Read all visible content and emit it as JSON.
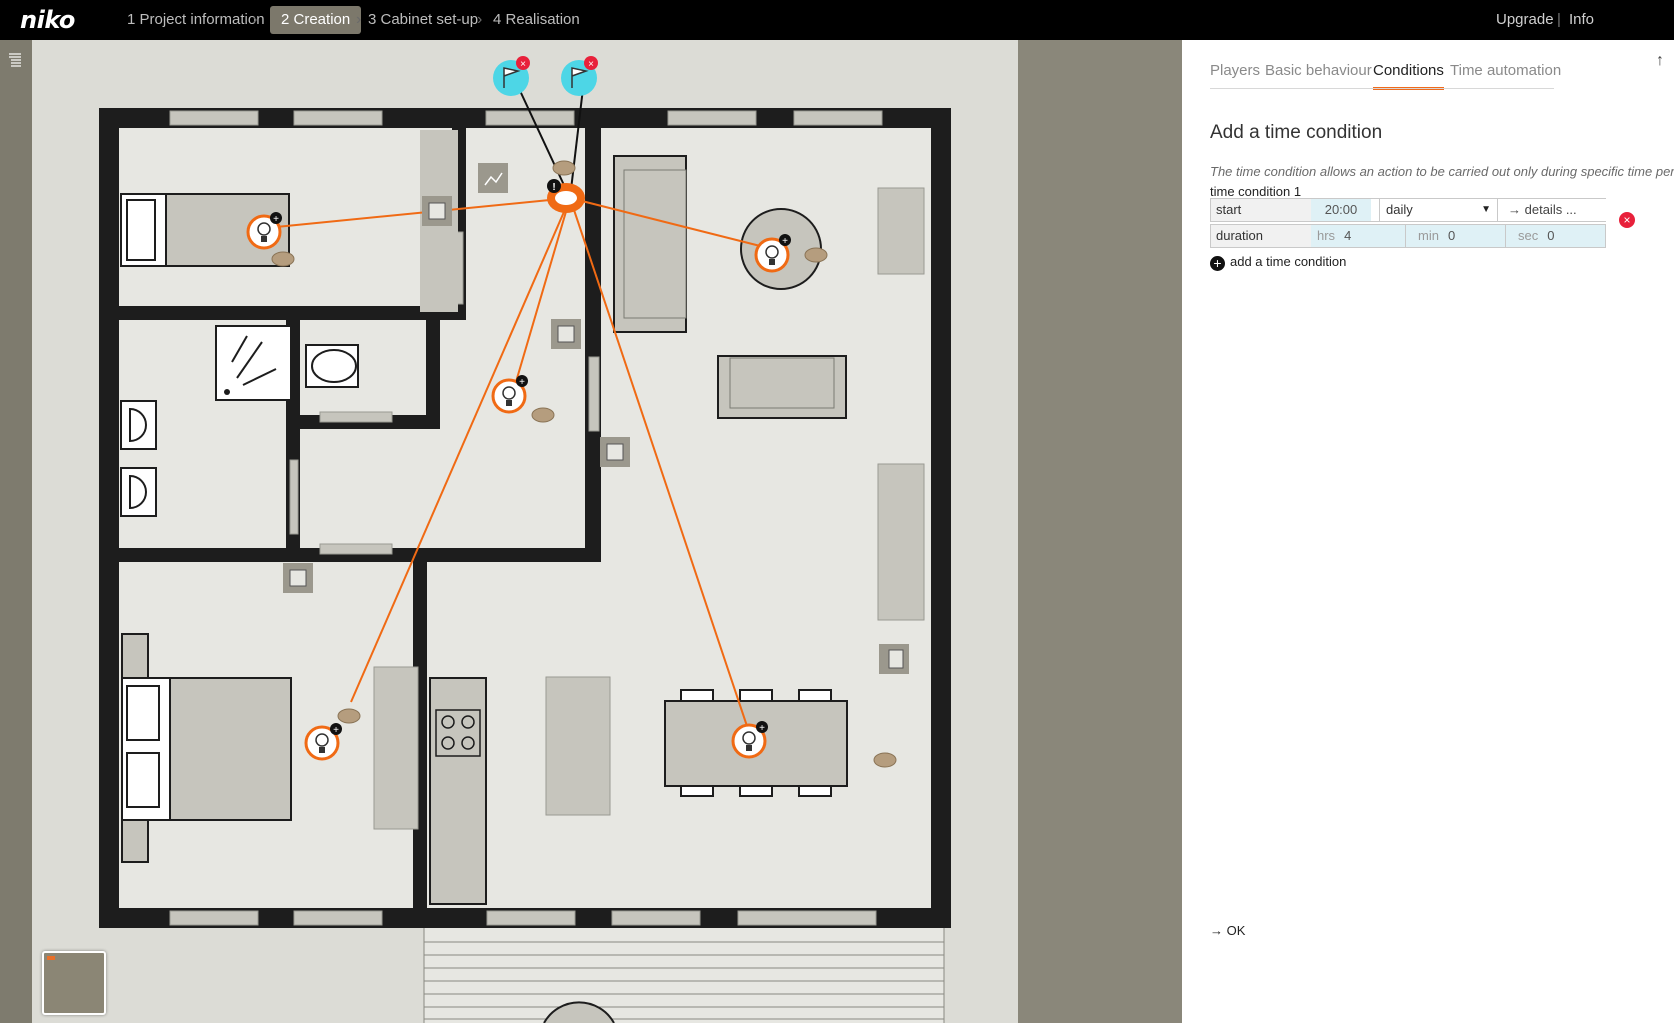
{
  "app": {
    "logo": "niko"
  },
  "nav": {
    "steps": [
      {
        "label": "1 Project information"
      },
      {
        "label": "2 Creation"
      },
      {
        "label": "3 Cabinet set-up"
      },
      {
        "label": "4 Realisation"
      }
    ],
    "active_step": 1,
    "right_links": {
      "upgrade": "Upgrade",
      "separator": "|",
      "info": "Info"
    }
  },
  "panel": {
    "tabs": [
      {
        "label": "Players"
      },
      {
        "label": "Basic behaviour"
      },
      {
        "label": "Conditions"
      },
      {
        "label": "Time automation"
      }
    ],
    "active_tab": 2,
    "title": "Add a time condition",
    "description": "The time condition allows an action to be carried out only during specific time periods.",
    "condition_label": "time condition 1",
    "start": {
      "label": "start",
      "time": "20:00",
      "frequency": "daily",
      "details": "details ..."
    },
    "duration": {
      "label": "duration",
      "hrs_label": "hrs",
      "hrs": "4",
      "min_label": "min",
      "min": "0",
      "sec_label": "sec",
      "sec": "0"
    },
    "add_condition": "add a time condition",
    "ok": "OK"
  },
  "colors": {
    "accent": "#ef6b1d",
    "flag": "#4dd6e6",
    "remove": "#e8213b",
    "wall": "#1d1d1d",
    "floor": "#e7e7e2",
    "furniture": "#c6c5bd"
  },
  "icons": [
    "menu-icon",
    "bulb-icon",
    "flag-icon",
    "switch-icon",
    "motion-sensor-icon",
    "remove-icon",
    "add-icon",
    "arrow-right-icon",
    "arrow-up-icon",
    "dropdown-caret-icon"
  ]
}
